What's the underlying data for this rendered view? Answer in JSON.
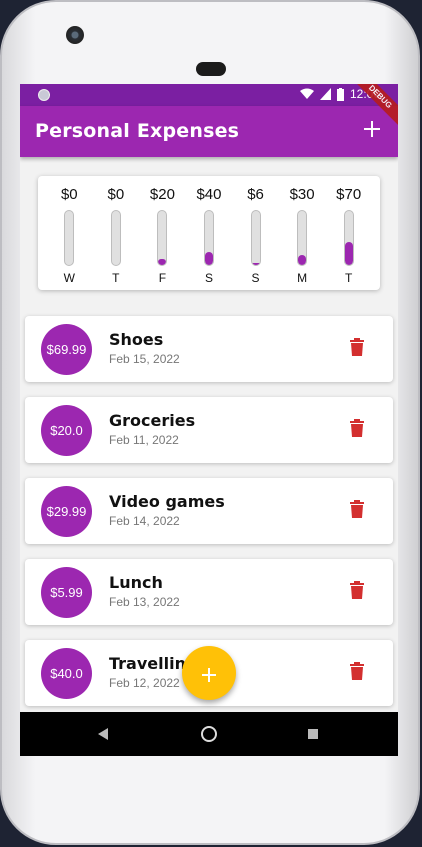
{
  "status_bar": {
    "time": "12:06"
  },
  "app_bar": {
    "title": "Personal Expenses",
    "add_icon": "plus-icon",
    "debug_banner": "DEBUG"
  },
  "colors": {
    "primary": "#9c27b0",
    "primary_dark": "#7b1fa2",
    "accent": "#ffc107",
    "delete": "#d32f2f"
  },
  "chart": {
    "days": [
      {
        "label": "W",
        "amount": "$0",
        "fill": 0.0
      },
      {
        "label": "T",
        "amount": "$0",
        "fill": 0.0
      },
      {
        "label": "F",
        "amount": "$20",
        "fill": 0.12
      },
      {
        "label": "S",
        "amount": "$40",
        "fill": 0.24
      },
      {
        "label": "S",
        "amount": "$6",
        "fill": 0.04
      },
      {
        "label": "M",
        "amount": "$30",
        "fill": 0.18
      },
      {
        "label": "T",
        "amount": "$70",
        "fill": 0.42
      }
    ]
  },
  "transactions": [
    {
      "amount": "$69.99",
      "title": "Shoes",
      "date": "Feb 15, 2022"
    },
    {
      "amount": "$20.0",
      "title": "Groceries",
      "date": "Feb 11, 2022"
    },
    {
      "amount": "$29.99",
      "title": "Video games",
      "date": "Feb 14, 2022"
    },
    {
      "amount": "$5.99",
      "title": "Lunch",
      "date": "Feb 13, 2022"
    },
    {
      "amount": "$40.0",
      "title": "Travelling",
      "date": "Feb 12, 2022"
    }
  ],
  "fab": {
    "icon": "plus-icon",
    "label": "+"
  }
}
